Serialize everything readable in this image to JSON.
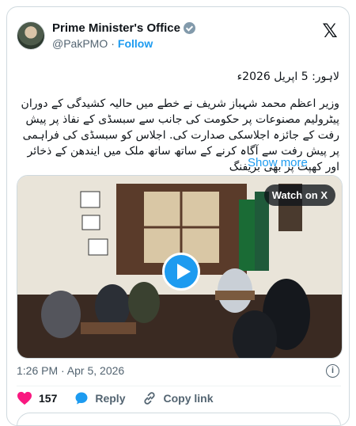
{
  "author": {
    "name": "Prime Minister's Office",
    "handle": "@PakPMO",
    "separator": "·",
    "follow_label": "Follow"
  },
  "post": {
    "line1": "لاہور: 5 اپریل 2026ء",
    "body": "وزیر اعظم محمد شہباز شریف نے خطے میں حالیہ کشیدگی کے دوران پیٹرولیم مصنوعات پر حکومت کی جانب سے سبسڈی کے نفاذ پر پیش رفت کے جائزہ اجلاسکی صدارت کی. اجلاس کو سبسڈی کی فراہمی پر پیش رفت سے آگاہ کرنے کے ساتھ ساتھ ملک میں ایندھن کے ذخائر اور کھپت پر بھی بریفنگ",
    "show_more": "Show more"
  },
  "media": {
    "watch_label": "Watch on X"
  },
  "meta": {
    "timestamp": "1:26 PM · Apr 5, 2026",
    "info_icon": "i"
  },
  "actions": {
    "likes": "157",
    "reply_label": "Reply",
    "copy_label": "Copy link"
  },
  "colors": {
    "accent": "#1d9bf0",
    "like": "#f91880",
    "muted": "#536471"
  },
  "icons": [
    "x-logo-icon",
    "verified-badge-icon",
    "play-icon",
    "info-icon",
    "heart-icon",
    "reply-icon",
    "link-icon"
  ]
}
